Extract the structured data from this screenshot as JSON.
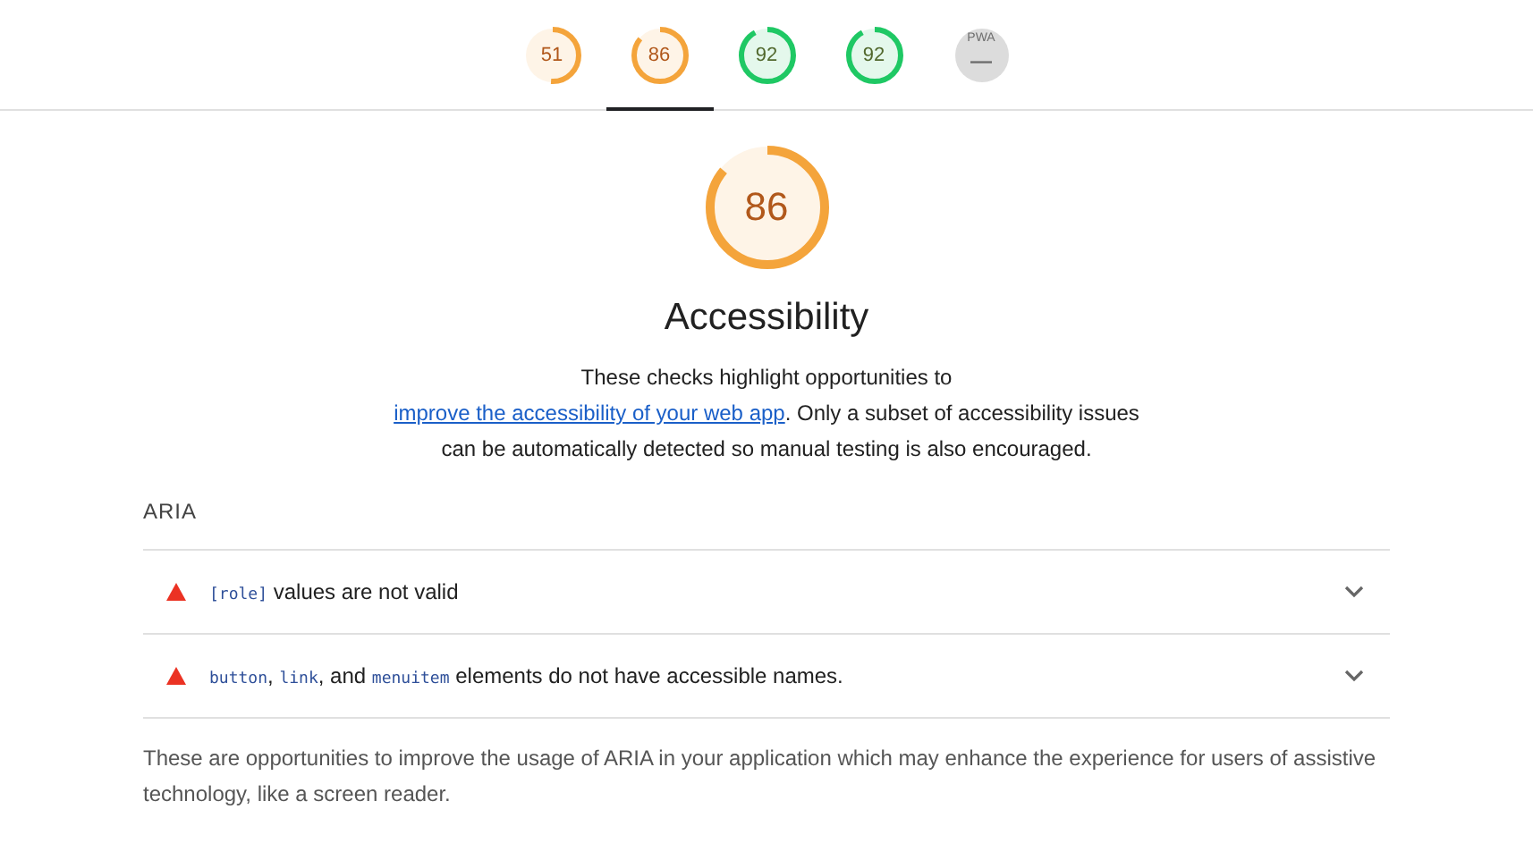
{
  "gauges": [
    {
      "score": "51",
      "color": "#f4a43b",
      "selected": false
    },
    {
      "score": "86",
      "color": "#f4a43b",
      "selected": true
    },
    {
      "score": "92",
      "color": "#1fc864",
      "selected": false
    },
    {
      "score": "92",
      "color": "#1fc864",
      "selected": false
    },
    {
      "score": "—",
      "label": "PWA",
      "color": "#dcdcdc",
      "selected": false
    }
  ],
  "category": {
    "score": "86",
    "color": "#f4a43b",
    "title": "Accessibility",
    "description": [
      {
        "kind": "text",
        "text": "These checks highlight opportunities to "
      },
      {
        "kind": "link",
        "text": "improve the accessibility of your web app"
      },
      {
        "kind": "text",
        "text": ". Only a subset of accessibility issues can be automatically detected so manual testing is also encouraged."
      }
    ]
  },
  "group": {
    "title": "ARIA",
    "audits": [
      {
        "color": "#eb3223",
        "title": [
          {
            "kind": "code",
            "text": "[role]"
          },
          {
            "kind": "text",
            "text": " values are not valid"
          }
        ]
      },
      {
        "color": "#eb3223",
        "title": [
          {
            "kind": "code",
            "text": "button"
          },
          {
            "kind": "text",
            "text": ", "
          },
          {
            "kind": "code",
            "text": "link"
          },
          {
            "kind": "text",
            "text": ", and "
          },
          {
            "kind": "code",
            "text": "menuitem"
          },
          {
            "kind": "text",
            "text": " elements do not have accessible names."
          }
        ]
      }
    ],
    "description": "These are opportunities to improve the usage of ARIA in your application which may enhance the experience for users of assistive technology, like a screen reader."
  }
}
